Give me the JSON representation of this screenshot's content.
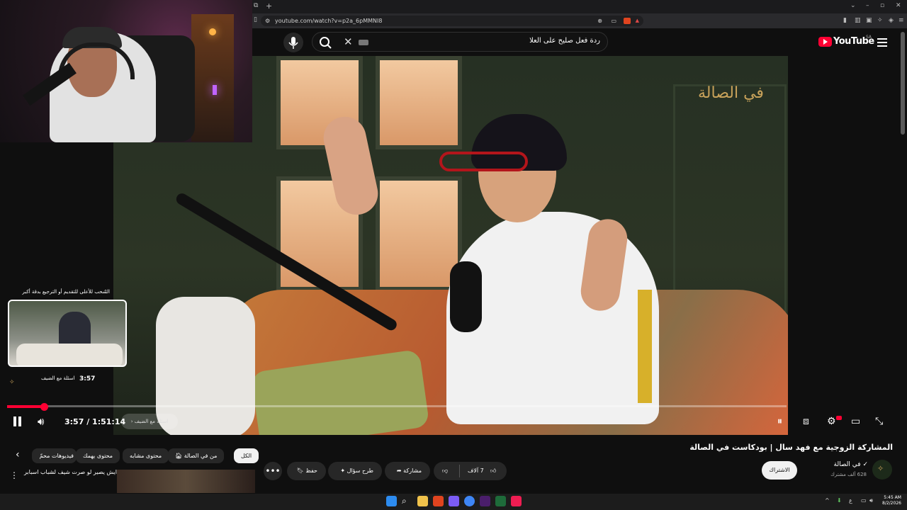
{
  "browser": {
    "url": "youtube.com/watch?v=p2a_6pMMNI8",
    "new_tab_icon": "plus-icon"
  },
  "header": {
    "search_query": "ردة فعل صليح على العلا",
    "logo_text": "YouTube",
    "country_code": "SA"
  },
  "player": {
    "drag_hint": "السحب للأعلى للتقديم أو الترجيع بدقة أكبر",
    "preview_time": "3:57",
    "preview_chapter": "اسئلة مع الضيف",
    "timecode": "3:57 / 1:51:14",
    "chapter_pill": "اسئلة مع الضيف",
    "progress_fraction": 0.047,
    "channel_watermark": "في الصالة"
  },
  "video": {
    "title": "المشاركة الزوجية مع فهد سال | بودكاست في الصالة",
    "channel_name": "في الصالة",
    "channel_subs": "628 ألف مشترك",
    "subscribe_label": "الاشتراك",
    "likes": "7 آلاف",
    "share_label": "مشاركة",
    "ask_label": "طرح سؤال",
    "save_label": "حفظ"
  },
  "chips": [
    {
      "label": "الكل",
      "active": true
    },
    {
      "label": "من في الصالة"
    },
    {
      "label": "محتوى مشابه"
    },
    {
      "label": "محتوى يهمك"
    },
    {
      "label": "فيديوهات محمّ"
    }
  ],
  "recommendation": {
    "title": "ايش يصير لو صرت شيف لشباب اسبابر"
  },
  "taskbar": {
    "time": "5:45 AM",
    "date": "8/2/2026",
    "lang": "ع"
  },
  "colors": {
    "accent": "#ff0033",
    "background": "#0f0f0f"
  }
}
